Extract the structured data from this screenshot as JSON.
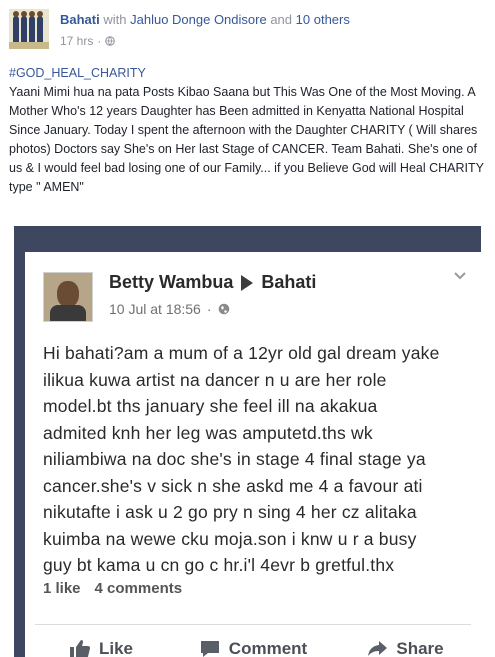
{
  "post": {
    "author": "Bahati",
    "with_text": "with",
    "tagged_person": "Jahluo Donge Ondisore",
    "and_text": "and",
    "others": "10 others",
    "time": "17 hrs",
    "separator": "·",
    "hashtag": "#GOD_HEAL_CHARITY",
    "text": "Yaani Mimi hua na pata Posts Kibao Saana but This Was One of the Most Moving. A Mother Who's 12 years Daughter has Been admitted in Kenyatta National Hospital Since January. Today I spent the afternoon with the Daughter CHARITY ( Will shares photos) Doctors say She's on Her last Stage of CANCER. Team Bahati. She's one of us & I would feel bad losing one of our Family... if you Believe God will Heal CHARITY type \" AMEN\""
  },
  "screenshot": {
    "author": "Betty Wambua",
    "target": "Bahati",
    "date": "10 Jul at 18:56",
    "separator": "·",
    "message": "Hi bahati?am a mum of a 12yr old gal dream yake\nilikua kuwa artist na dancer n u are her role\nmodel.bt ths january she feel ill na akakua\nadmited knh her leg was amputetd.ths wk\nniliambiwa na doc she's in stage 4 final stage ya\ncancer.she's v sick n she askd me 4 a favour ati\nnikutafte i ask u 2 go pry n sing 4 her cz alitaka\nkuimba na wewe cku moja.son i knw u r a busy\nguy bt kama u cn go c hr.i'l 4evr b gretful.thx",
    "likes": "1 like",
    "comments": "4 comments",
    "actions": {
      "like": "Like",
      "comment": "Comment",
      "share": "Share"
    }
  },
  "colors": {
    "link": "#365899",
    "meta": "#90949c",
    "photo_bg": "#3d4760"
  }
}
